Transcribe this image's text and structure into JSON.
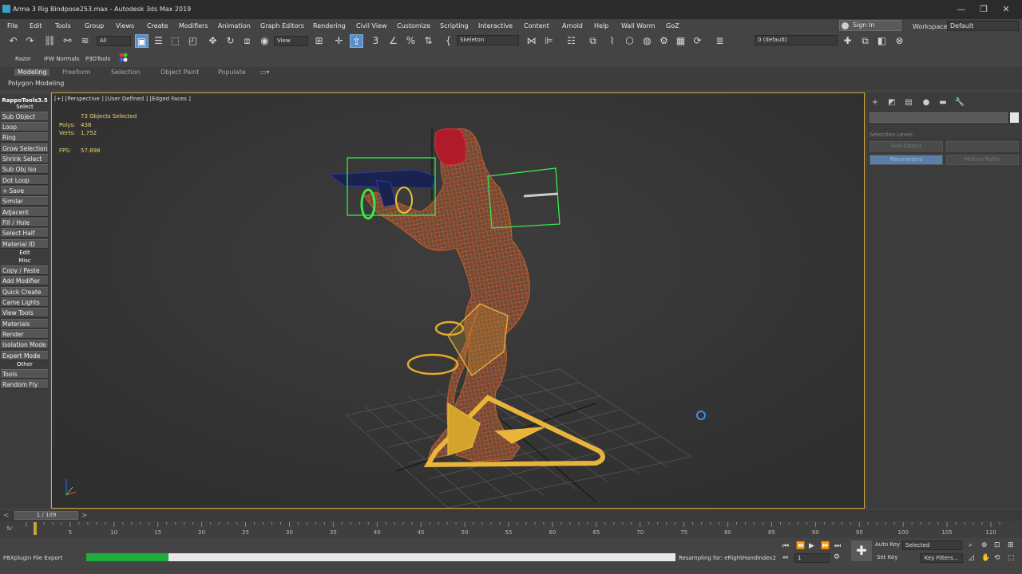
{
  "app": {
    "title": "Arma 3 Rig Bindpose253.max - Autodesk 3ds Max 2019",
    "window_buttons": [
      "—",
      "❐",
      "✕"
    ]
  },
  "menu": {
    "items": [
      "File",
      "Edit",
      "Tools",
      "Group",
      "Views",
      "Create",
      "Modifiers",
      "Animation",
      "Graph Editors",
      "Rendering",
      "Civil View",
      "Customize",
      "Scripting",
      "Interactive",
      "Content",
      "Arnold",
      "Help",
      "Wall Worm",
      "GoZ"
    ],
    "sign_in": "Sign In",
    "workspaces_label": "Workspaces:",
    "workspace_value": "Default"
  },
  "toolbar": {
    "filter_value": "All",
    "refcoord_value": "View",
    "selection_set_value": "Skeleton",
    "layer_value": "0 (default)"
  },
  "plugins": {
    "items": [
      "Razor",
      "IFW Normals",
      "P3DTools"
    ]
  },
  "ribbon": {
    "tabs": [
      "Modeling",
      "Freeform",
      "Selection",
      "Object Paint",
      "Populate"
    ],
    "panel_label": "Polygon Modeling"
  },
  "left_panel": {
    "title": "RappoTools3.5",
    "sections": [
      {
        "header": "Select",
        "buttons": [
          "Sub Object",
          "Loop",
          "Ring",
          "Grow Selection",
          "Shrink Select",
          "Sub Obj Iso",
          "Dot Loop",
          "+ Save",
          "Similar",
          "Adjacent",
          "Fill / Hole",
          "Select Half",
          "Material ID"
        ]
      },
      {
        "header": "Edit",
        "buttons": []
      },
      {
        "header": "Misc",
        "buttons": [
          "Copy / Paste",
          "Add Modifier",
          "Quick Create",
          "Came Lights",
          "View Tools",
          "Materials",
          "Render",
          "Isolation Mode",
          "Expert Mode"
        ]
      },
      {
        "header": "Other",
        "buttons": [
          "Tools",
          "Random Fly"
        ]
      }
    ]
  },
  "viewport": {
    "label": "[+] [Perspective ] [User Defined ] [Edged Faces ]",
    "stats": {
      "selected": "73 Objects Selected",
      "polys_label": "Polys:",
      "polys_value": "438",
      "verts_label": "Verts:",
      "verts_value": "1,752",
      "fps_label": "FPS:",
      "fps_value": "57.898"
    }
  },
  "command_panel": {
    "selection_level": "Selection Level:",
    "buttons": [
      "Sub-Object",
      "",
      "Parameters",
      "Motion Paths"
    ]
  },
  "timeline": {
    "slider": "1 / 109",
    "ticks": [
      "5",
      "10",
      "15",
      "20",
      "25",
      "30",
      "35",
      "40",
      "45",
      "50",
      "55",
      "60",
      "65",
      "70",
      "75",
      "80",
      "85",
      "90",
      "95",
      "100",
      "105",
      "110"
    ]
  },
  "status": {
    "left": "FBXplugin File Export",
    "progress": 0.14,
    "message": "Resampling for: eRightHandIndex2",
    "auto_key": "Auto Key",
    "set_key": "Set Key",
    "selected": "Selected",
    "key_filters": "Key Filters...",
    "frame": "1"
  },
  "colors": {
    "viewport_border": "#d9a53b",
    "stats": "#f2d76a",
    "progress": "#1fae3b",
    "active": "#5b8ec4"
  }
}
